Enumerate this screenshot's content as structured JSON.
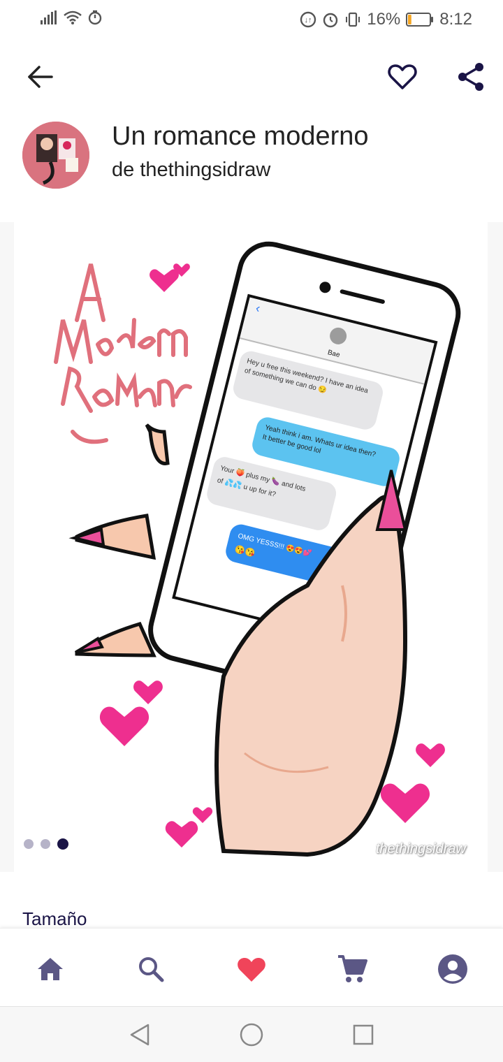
{
  "status_bar": {
    "battery_percent": "16%",
    "time": "8:12",
    "icons": [
      "signal-icon",
      "wifi-icon",
      "timer-icon",
      "data-saver-icon",
      "alarm-icon",
      "vibrate-icon",
      "battery-icon"
    ],
    "battery_level": 0.16,
    "battery_color": "#f5a623"
  },
  "header": {
    "icons": [
      "back-arrow-icon",
      "heart-outline-icon",
      "share-icon"
    ]
  },
  "product": {
    "title": "Un romance moderno",
    "artist": "de thethingsidraw"
  },
  "artwork": {
    "lettering": "A Modern Romance",
    "contact_name": "Bae",
    "messages": [
      "Hey u free this weekend? I have an idea of something we can do 😏",
      "Yeah think i am. Whats ur idea then? It better be good lol",
      "Your 🍑 plus my 🍆 and lots of 💦💦 u up for it?",
      "OMG YESSS!!! 😍😍💕 😘😘"
    ],
    "watermark": "thethingsidraw"
  },
  "carousel": {
    "count": 3,
    "active": 3
  },
  "size_section": {
    "label": "Tamaño"
  },
  "bottom_nav": {
    "items": [
      "home-icon",
      "search-icon",
      "heart-icon",
      "cart-icon",
      "account-icon"
    ],
    "active_color": "#f0445a",
    "inactive_color": "#5b5785"
  },
  "system_nav": {
    "items": [
      "back-triangle-icon",
      "home-circle-icon",
      "recents-square-icon"
    ]
  },
  "colors": {
    "accent_dark": "#1a1446",
    "heart_pink": "#ee2f8f",
    "lettering_pink": "#e0707c",
    "bubble_blue": "#5cc3f0"
  }
}
